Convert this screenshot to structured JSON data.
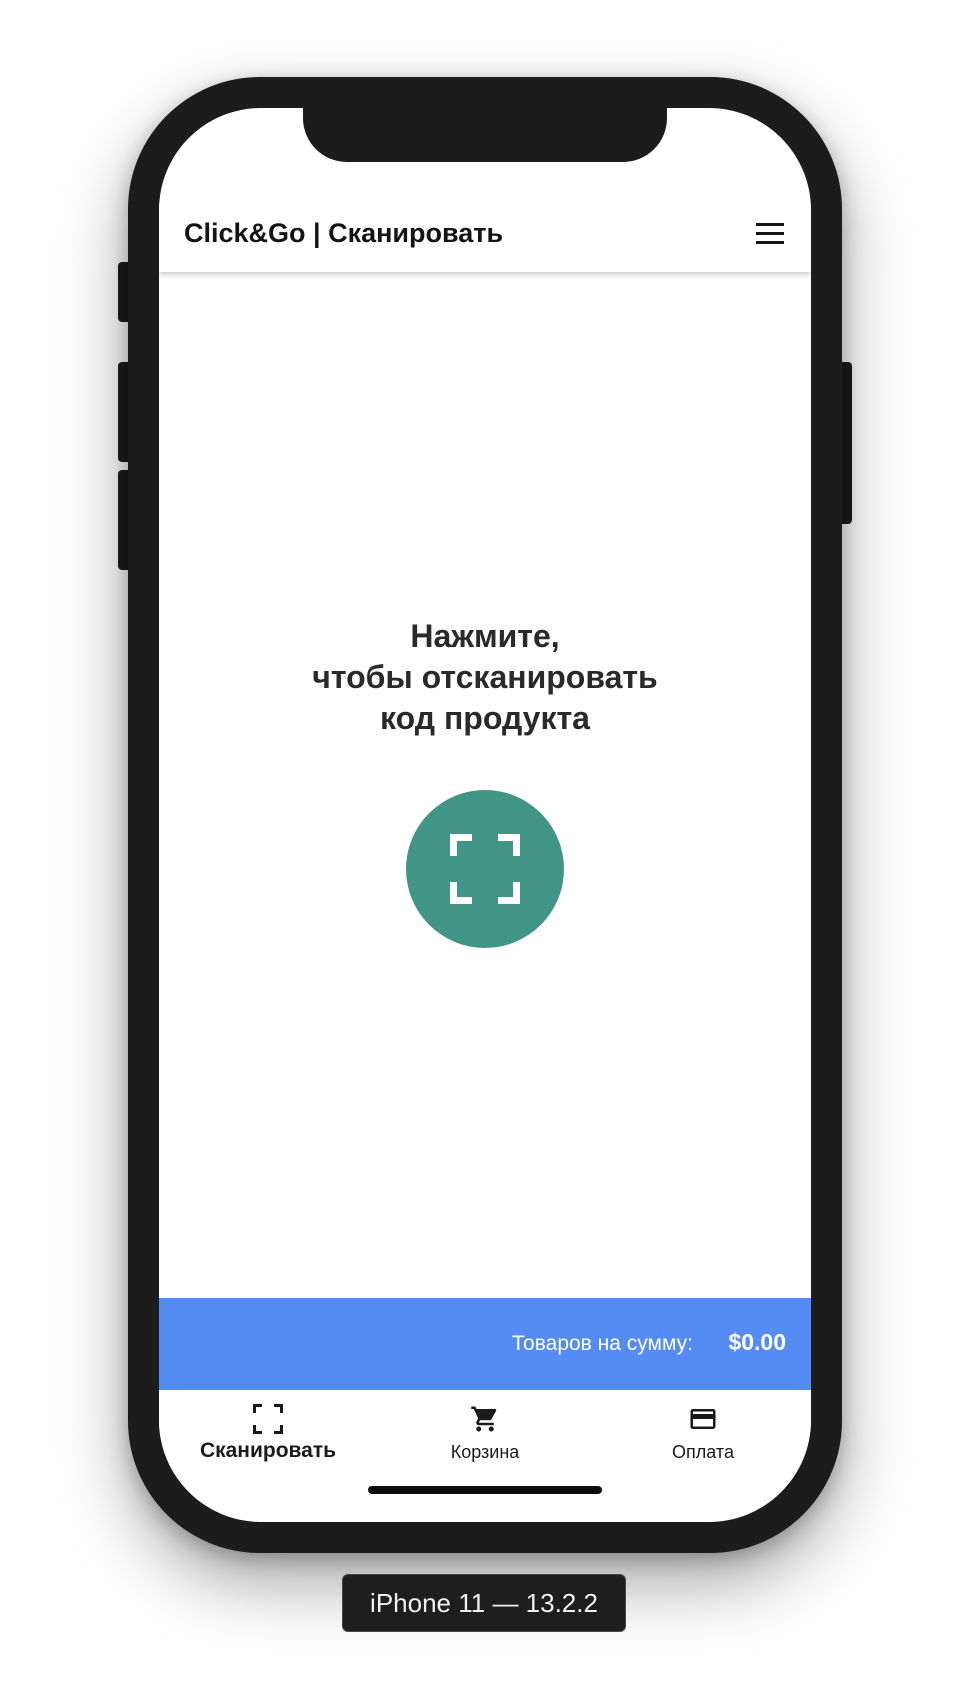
{
  "header": {
    "title": "Click&Go | Сканировать",
    "menu_icon": "hamburger-menu-icon"
  },
  "main": {
    "prompt_line1": "Нажмите,",
    "prompt_line2": "чтобы отсканировать",
    "prompt_line3": "код продукта",
    "scan_button_icon": "scan-frame-icon",
    "scan_button_color": "#419587"
  },
  "summary": {
    "label": "Товаров на сумму:",
    "amount": "$0.00",
    "bar_color": "#558cf4"
  },
  "tabs": [
    {
      "label": "Сканировать",
      "icon": "scan-frame-icon",
      "active": true
    },
    {
      "label": "Корзина",
      "icon": "shopping-cart-icon",
      "active": false
    },
    {
      "label": "Оплата",
      "icon": "credit-card-icon",
      "active": false
    }
  ],
  "device_caption": "iPhone 11 — 13.2.2"
}
